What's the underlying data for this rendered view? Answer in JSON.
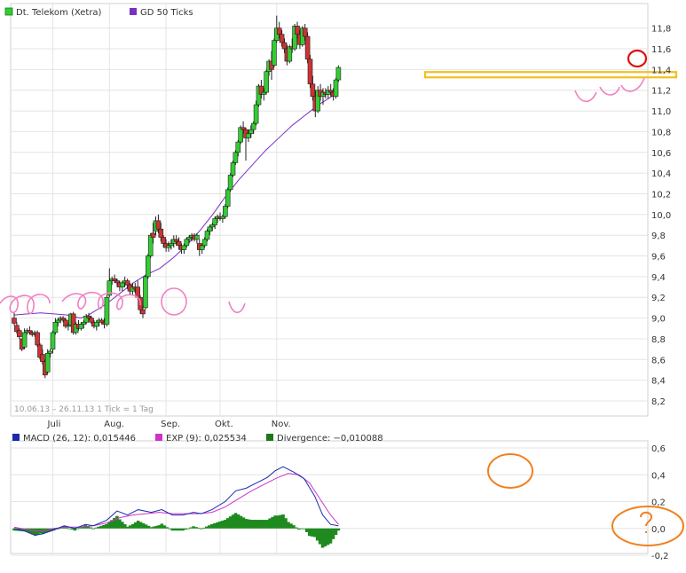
{
  "chart_data": [
    {
      "type": "candlestick",
      "legend": [
        {
          "label": "Dt. Telekom (Xetra)",
          "color": "#33aa33"
        },
        {
          "label": "GD 50 Ticks",
          "color": "#7a2fc4"
        }
      ],
      "footer": "10.06.13 – 26.11.13   1 Tick = 1 Tag",
      "x_ticks": [
        "Juli",
        "Aug.",
        "Sep.",
        "Okt.",
        "Nov."
      ],
      "y_ticks": [
        "8,2",
        "8,4",
        "8,6",
        "8,8",
        "9,0",
        "9,2",
        "9,4",
        "9,6",
        "9,8",
        "10,0",
        "10,2",
        "10,4",
        "10,6",
        "10,8",
        "11,0",
        "11,2",
        "11,4",
        "11,6",
        "11,8"
      ],
      "ylim": [
        8.2,
        11.9
      ],
      "colors": {
        "up": "#33cc33",
        "down": "#cc3333",
        "ma": "#7a2fc4",
        "grid": "#e4e4e4",
        "resistance": "#f0c020",
        "annotation_pink": "#f080c0",
        "annotation_red": "#e01010"
      },
      "resistance_level": 11.35,
      "candles": [
        [
          9.0,
          9.05,
          8.93,
          8.95
        ],
        [
          8.93,
          8.96,
          8.85,
          8.87
        ],
        [
          8.88,
          8.9,
          8.8,
          8.82
        ],
        [
          8.8,
          8.8,
          8.68,
          8.7
        ],
        [
          8.72,
          8.9,
          8.7,
          8.86
        ],
        [
          8.86,
          8.9,
          8.84,
          8.88
        ],
        [
          8.88,
          8.92,
          8.84,
          8.86
        ],
        [
          8.86,
          8.88,
          8.82,
          8.84
        ],
        [
          8.85,
          8.88,
          8.82,
          8.86
        ],
        [
          8.86,
          8.88,
          8.72,
          8.74
        ],
        [
          8.74,
          8.76,
          8.6,
          8.62
        ],
        [
          8.65,
          8.7,
          8.55,
          8.58
        ],
        [
          8.58,
          8.6,
          8.42,
          8.45
        ],
        [
          8.48,
          8.7,
          8.46,
          8.66
        ],
        [
          8.66,
          8.7,
          8.62,
          8.68
        ],
        [
          8.7,
          8.88,
          8.66,
          8.86
        ],
        [
          8.86,
          9.0,
          8.84,
          8.96
        ],
        [
          8.96,
          9.0,
          8.92,
          8.98
        ],
        [
          8.98,
          9.02,
          8.95,
          9.0
        ],
        [
          9.0,
          9.02,
          8.96,
          8.98
        ],
        [
          8.98,
          9.0,
          8.9,
          8.92
        ],
        [
          8.92,
          8.95,
          8.88,
          8.93
        ],
        [
          8.93,
          9.05,
          8.92,
          9.04
        ],
        [
          9.04,
          9.06,
          8.84,
          8.86
        ],
        [
          8.86,
          8.96,
          8.84,
          8.94
        ],
        [
          8.94,
          8.98,
          8.88,
          8.9
        ],
        [
          8.9,
          8.96,
          8.88,
          8.94
        ],
        [
          8.94,
          8.98,
          8.9,
          8.96
        ],
        [
          8.96,
          9.04,
          8.94,
          9.02
        ],
        [
          9.02,
          9.05,
          8.98,
          9.0
        ],
        [
          9.0,
          9.02,
          8.94,
          8.96
        ],
        [
          8.96,
          8.98,
          8.9,
          8.92
        ],
        [
          8.92,
          8.98,
          8.88,
          8.96
        ],
        [
          8.96,
          9.0,
          8.92,
          8.98
        ],
        [
          8.98,
          9.0,
          8.94,
          8.96
        ],
        [
          8.96,
          9.0,
          8.9,
          8.94
        ],
        [
          8.94,
          9.22,
          8.92,
          9.2
        ],
        [
          9.22,
          9.48,
          9.2,
          9.36
        ],
        [
          9.36,
          9.4,
          9.32,
          9.38
        ],
        [
          9.38,
          9.42,
          9.34,
          9.36
        ],
        [
          9.36,
          9.38,
          9.3,
          9.34
        ],
        [
          9.34,
          9.36,
          9.26,
          9.3
        ],
        [
          9.3,
          9.36,
          9.26,
          9.34
        ],
        [
          9.34,
          9.4,
          9.3,
          9.36
        ],
        [
          9.36,
          9.38,
          9.28,
          9.32
        ],
        [
          9.32,
          9.34,
          9.22,
          9.26
        ],
        [
          9.26,
          9.34,
          9.22,
          9.3
        ],
        [
          9.3,
          9.34,
          9.24,
          9.28
        ],
        [
          9.3,
          9.36,
          9.18,
          9.2
        ],
        [
          9.2,
          9.22,
          9.04,
          9.08
        ],
        [
          9.08,
          9.12,
          9.0,
          9.04
        ],
        [
          9.1,
          9.42,
          9.08,
          9.4
        ],
        [
          9.4,
          9.62,
          9.38,
          9.6
        ],
        [
          9.6,
          9.82,
          9.58,
          9.8
        ],
        [
          9.82,
          9.92,
          9.72,
          9.78
        ],
        [
          9.84,
          9.98,
          9.8,
          9.94
        ],
        [
          9.94,
          10.0,
          9.82,
          9.86
        ],
        [
          9.86,
          9.92,
          9.74,
          9.78
        ],
        [
          9.78,
          9.8,
          9.68,
          9.72
        ],
        [
          9.72,
          9.76,
          9.64,
          9.68
        ],
        [
          9.68,
          9.74,
          9.64,
          9.7
        ],
        [
          9.7,
          9.76,
          9.66,
          9.72
        ],
        [
          9.72,
          9.8,
          9.68,
          9.76
        ],
        [
          9.76,
          9.8,
          9.7,
          9.74
        ],
        [
          9.74,
          9.78,
          9.66,
          9.7
        ],
        [
          9.7,
          9.72,
          9.62,
          9.66
        ],
        [
          9.66,
          9.72,
          9.62,
          9.7
        ],
        [
          9.7,
          9.78,
          9.68,
          9.76
        ],
        [
          9.76,
          9.8,
          9.72,
          9.78
        ],
        [
          9.78,
          9.82,
          9.74,
          9.8
        ],
        [
          9.8,
          9.82,
          9.74,
          9.76
        ],
        [
          9.76,
          9.82,
          9.72,
          9.8
        ],
        [
          9.72,
          9.76,
          9.6,
          9.66
        ],
        [
          9.66,
          9.72,
          9.62,
          9.7
        ],
        [
          9.7,
          9.78,
          9.68,
          9.76
        ],
        [
          9.76,
          9.86,
          9.74,
          9.84
        ],
        [
          9.84,
          9.9,
          9.8,
          9.88
        ],
        [
          9.88,
          9.92,
          9.84,
          9.9
        ],
        [
          9.9,
          9.98,
          9.86,
          9.96
        ],
        [
          9.96,
          10.0,
          9.92,
          9.98
        ],
        [
          9.98,
          10.02,
          9.94,
          9.96
        ],
        [
          9.96,
          10.0,
          9.92,
          9.98
        ],
        [
          9.98,
          10.1,
          9.96,
          10.08
        ],
        [
          10.08,
          10.26,
          10.06,
          10.24
        ],
        [
          10.24,
          10.4,
          10.22,
          10.38
        ],
        [
          10.38,
          10.52,
          10.36,
          10.5
        ],
        [
          10.5,
          10.62,
          10.48,
          10.6
        ],
        [
          10.6,
          10.72,
          10.56,
          10.7
        ],
        [
          10.7,
          10.86,
          10.68,
          10.84
        ],
        [
          10.84,
          10.9,
          10.78,
          10.82
        ],
        [
          10.82,
          10.84,
          10.52,
          10.74
        ],
        [
          10.74,
          10.82,
          10.7,
          10.78
        ],
        [
          10.78,
          10.86,
          10.74,
          10.82
        ],
        [
          10.82,
          10.9,
          10.78,
          10.88
        ],
        [
          10.88,
          11.1,
          10.86,
          11.06
        ],
        [
          11.06,
          11.26,
          11.04,
          11.24
        ],
        [
          11.24,
          11.3,
          11.12,
          11.16
        ],
        [
          11.16,
          11.22,
          11.1,
          11.18
        ],
        [
          11.18,
          11.4,
          11.16,
          11.38
        ],
        [
          11.38,
          11.5,
          11.34,
          11.48
        ],
        [
          11.48,
          11.58,
          11.3,
          11.4
        ],
        [
          11.44,
          11.7,
          11.42,
          11.68
        ],
        [
          11.68,
          11.92,
          11.66,
          11.8
        ],
        [
          11.8,
          11.86,
          11.7,
          11.74
        ],
        [
          11.74,
          11.78,
          11.62,
          11.66
        ],
        [
          11.66,
          11.7,
          11.56,
          11.6
        ],
        [
          11.6,
          11.64,
          11.44,
          11.48
        ],
        [
          11.48,
          11.64,
          11.46,
          11.62
        ],
        [
          11.62,
          11.7,
          11.56,
          11.6
        ],
        [
          11.6,
          11.84,
          11.58,
          11.82
        ],
        [
          11.82,
          11.86,
          11.7,
          11.74
        ],
        [
          11.74,
          11.78,
          11.6,
          11.64
        ],
        [
          11.64,
          11.82,
          11.62,
          11.8
        ],
        [
          11.8,
          11.84,
          11.68,
          11.72
        ],
        [
          11.72,
          11.76,
          11.46,
          11.5
        ],
        [
          11.5,
          11.54,
          11.22,
          11.26
        ],
        [
          11.26,
          11.34,
          11.1,
          11.14
        ],
        [
          11.14,
          11.2,
          10.94,
          11.0
        ],
        [
          11.0,
          11.24,
          10.98,
          11.2
        ],
        [
          11.2,
          11.26,
          11.1,
          11.14
        ],
        [
          11.14,
          11.22,
          11.06,
          11.18
        ],
        [
          11.18,
          11.22,
          11.12,
          11.16
        ],
        [
          11.16,
          11.24,
          11.12,
          11.2
        ],
        [
          11.2,
          11.26,
          11.14,
          11.18
        ],
        [
          11.18,
          11.22,
          11.1,
          11.14
        ],
        [
          11.14,
          11.32,
          11.12,
          11.3
        ],
        [
          11.3,
          11.44,
          11.28,
          11.42
        ]
      ],
      "ma50": [
        [
          0,
          9.03
        ],
        [
          10,
          9.04
        ],
        [
          20,
          9.05
        ],
        [
          30,
          9.04
        ],
        [
          40,
          9.03
        ],
        [
          50,
          9.0
        ],
        [
          55,
          9.02
        ],
        [
          60,
          9.06
        ],
        [
          70,
          9.14
        ],
        [
          80,
          9.24
        ],
        [
          90,
          9.34
        ],
        [
          100,
          9.42
        ],
        [
          110,
          9.48
        ],
        [
          120,
          9.58
        ],
        [
          130,
          9.7
        ],
        [
          140,
          9.84
        ],
        [
          150,
          10.0
        ],
        [
          160,
          10.18
        ],
        [
          170,
          10.34
        ],
        [
          180,
          10.48
        ],
        [
          190,
          10.62
        ],
        [
          200,
          10.74
        ],
        [
          210,
          10.86
        ],
        [
          220,
          10.96
        ],
        [
          230,
          11.06
        ],
        [
          240,
          11.14
        ],
        [
          245,
          11.18
        ]
      ]
    },
    {
      "type": "macd",
      "legend": [
        {
          "label": "MACD (26, 12): 0,015446",
          "color": "#1a2bb0"
        },
        {
          "label": "EXP (9): 0,025534",
          "color": "#cc33cc"
        },
        {
          "label": "Divergence: −0,010088",
          "color": "#1a7a1a"
        }
      ],
      "y_ticks": [
        "-0,2",
        "0,0",
        "0,2",
        "0,4",
        "0,6"
      ],
      "ylim": [
        -0.2,
        0.6
      ],
      "macd": [
        [
          0,
          0.0
        ],
        [
          8,
          -0.02
        ],
        [
          16,
          -0.05
        ],
        [
          22,
          -0.04
        ],
        [
          30,
          -0.01
        ],
        [
          38,
          0.02
        ],
        [
          46,
          0.0
        ],
        [
          54,
          0.03
        ],
        [
          60,
          0.02
        ],
        [
          70,
          0.06
        ],
        [
          78,
          0.13
        ],
        [
          86,
          0.1
        ],
        [
          94,
          0.14
        ],
        [
          104,
          0.12
        ],
        [
          112,
          0.14
        ],
        [
          120,
          0.1
        ],
        [
          128,
          0.1
        ],
        [
          136,
          0.12
        ],
        [
          142,
          0.11
        ],
        [
          150,
          0.14
        ],
        [
          160,
          0.2
        ],
        [
          168,
          0.28
        ],
        [
          176,
          0.3
        ],
        [
          184,
          0.34
        ],
        [
          192,
          0.38
        ],
        [
          198,
          0.43
        ],
        [
          204,
          0.46
        ],
        [
          212,
          0.42
        ],
        [
          220,
          0.37
        ],
        [
          228,
          0.24
        ],
        [
          234,
          0.1
        ],
        [
          240,
          0.03
        ],
        [
          246,
          0.02
        ]
      ],
      "signal": [
        [
          0,
          0.01
        ],
        [
          10,
          -0.01
        ],
        [
          20,
          -0.02
        ],
        [
          30,
          0.0
        ],
        [
          40,
          0.01
        ],
        [
          50,
          0.01
        ],
        [
          60,
          0.02
        ],
        [
          70,
          0.04
        ],
        [
          80,
          0.08
        ],
        [
          90,
          0.1
        ],
        [
          100,
          0.11
        ],
        [
          110,
          0.12
        ],
        [
          120,
          0.11
        ],
        [
          130,
          0.11
        ],
        [
          140,
          0.11
        ],
        [
          150,
          0.12
        ],
        [
          160,
          0.16
        ],
        [
          170,
          0.22
        ],
        [
          180,
          0.28
        ],
        [
          190,
          0.33
        ],
        [
          200,
          0.38
        ],
        [
          208,
          0.41
        ],
        [
          216,
          0.4
        ],
        [
          224,
          0.34
        ],
        [
          232,
          0.22
        ],
        [
          240,
          0.1
        ],
        [
          246,
          0.03
        ]
      ],
      "divergence": "macd minus signal"
    }
  ]
}
